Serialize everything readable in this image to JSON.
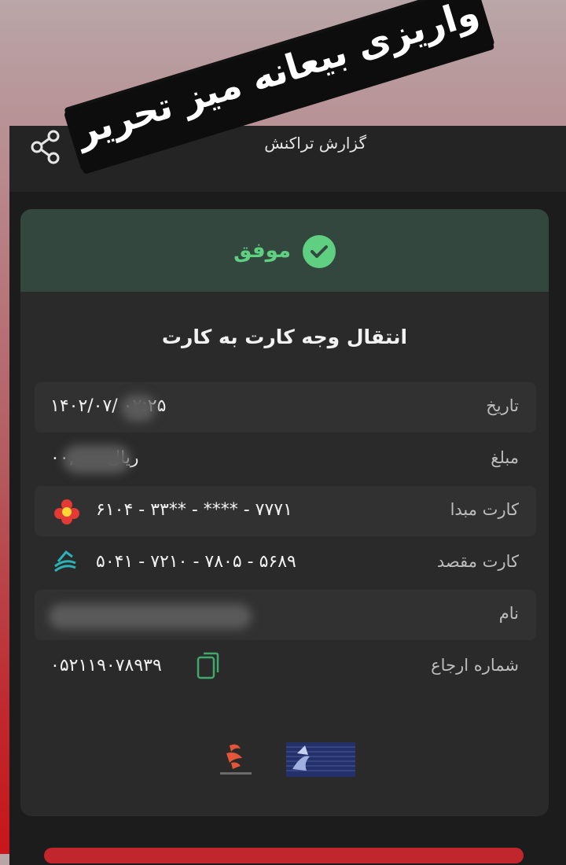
{
  "overlay": {
    "text": "واریزی بیعانه میز تحریر"
  },
  "appbar": {
    "title": "گزارش تراکنش",
    "share_icon": "share-icon"
  },
  "status": {
    "label": "موفق",
    "icon": "check-circle-icon",
    "color": "#5fcf82"
  },
  "transaction": {
    "title": "انتقال وجه کارت به کارت",
    "rows": [
      {
        "label": "تاریخ",
        "value": "۱۴۰۲/۰۷/    ۰۲:۲۵"
      },
      {
        "label": "مبلغ",
        "value": "۰۰,۰۰۰ ریال"
      },
      {
        "label": "کارت مبدا",
        "value": "۶۱۰۴ - ۳۳** - **** - ۷۷۷۱"
      },
      {
        "label": "کارت مقصد",
        "value": "۵۰۴۱ - ۷۲۱۰ - ۷۸۰۵ - ۵۶۸۹"
      },
      {
        "label": "نام",
        "value": ""
      },
      {
        "label": "شماره ارجاع",
        "value": "۰۵۲۱۱۹۰۷۸۹۳۹"
      }
    ]
  },
  "colors": {
    "status_bg": "#33473f",
    "card_bg": "#2a2a2a",
    "accent_green": "#5fcf82"
  }
}
